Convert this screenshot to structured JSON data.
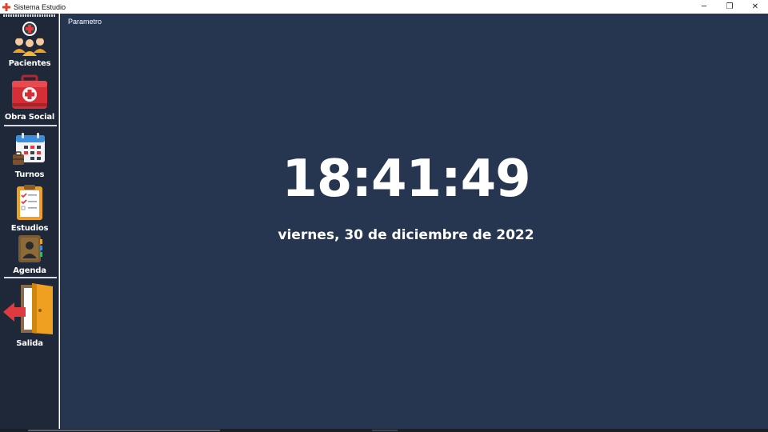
{
  "window": {
    "title": "Sistema Estudio",
    "controls": {
      "minimize": "─",
      "restore": "❐",
      "close": "✕"
    }
  },
  "sidebar": {
    "items": [
      {
        "label": "Pacientes",
        "icon": "patients-icon"
      },
      {
        "label": "Obra Social",
        "icon": "medical-bag-icon"
      },
      {
        "label": "Turnos",
        "icon": "calendar-icon"
      },
      {
        "label": "Estudios",
        "icon": "clipboard-icon"
      },
      {
        "label": "Agenda",
        "icon": "contact-book-icon"
      },
      {
        "label": "Salida",
        "icon": "exit-door-icon"
      }
    ]
  },
  "main": {
    "section_label": "Parametro",
    "clock": "18:41:49",
    "date": "viernes, 30 de diciembre de 2022"
  },
  "colors": {
    "sidebar_bg": "#1e2838",
    "main_bg": "#273650",
    "accent_red": "#e03a3e",
    "accent_orange": "#f0a020"
  }
}
